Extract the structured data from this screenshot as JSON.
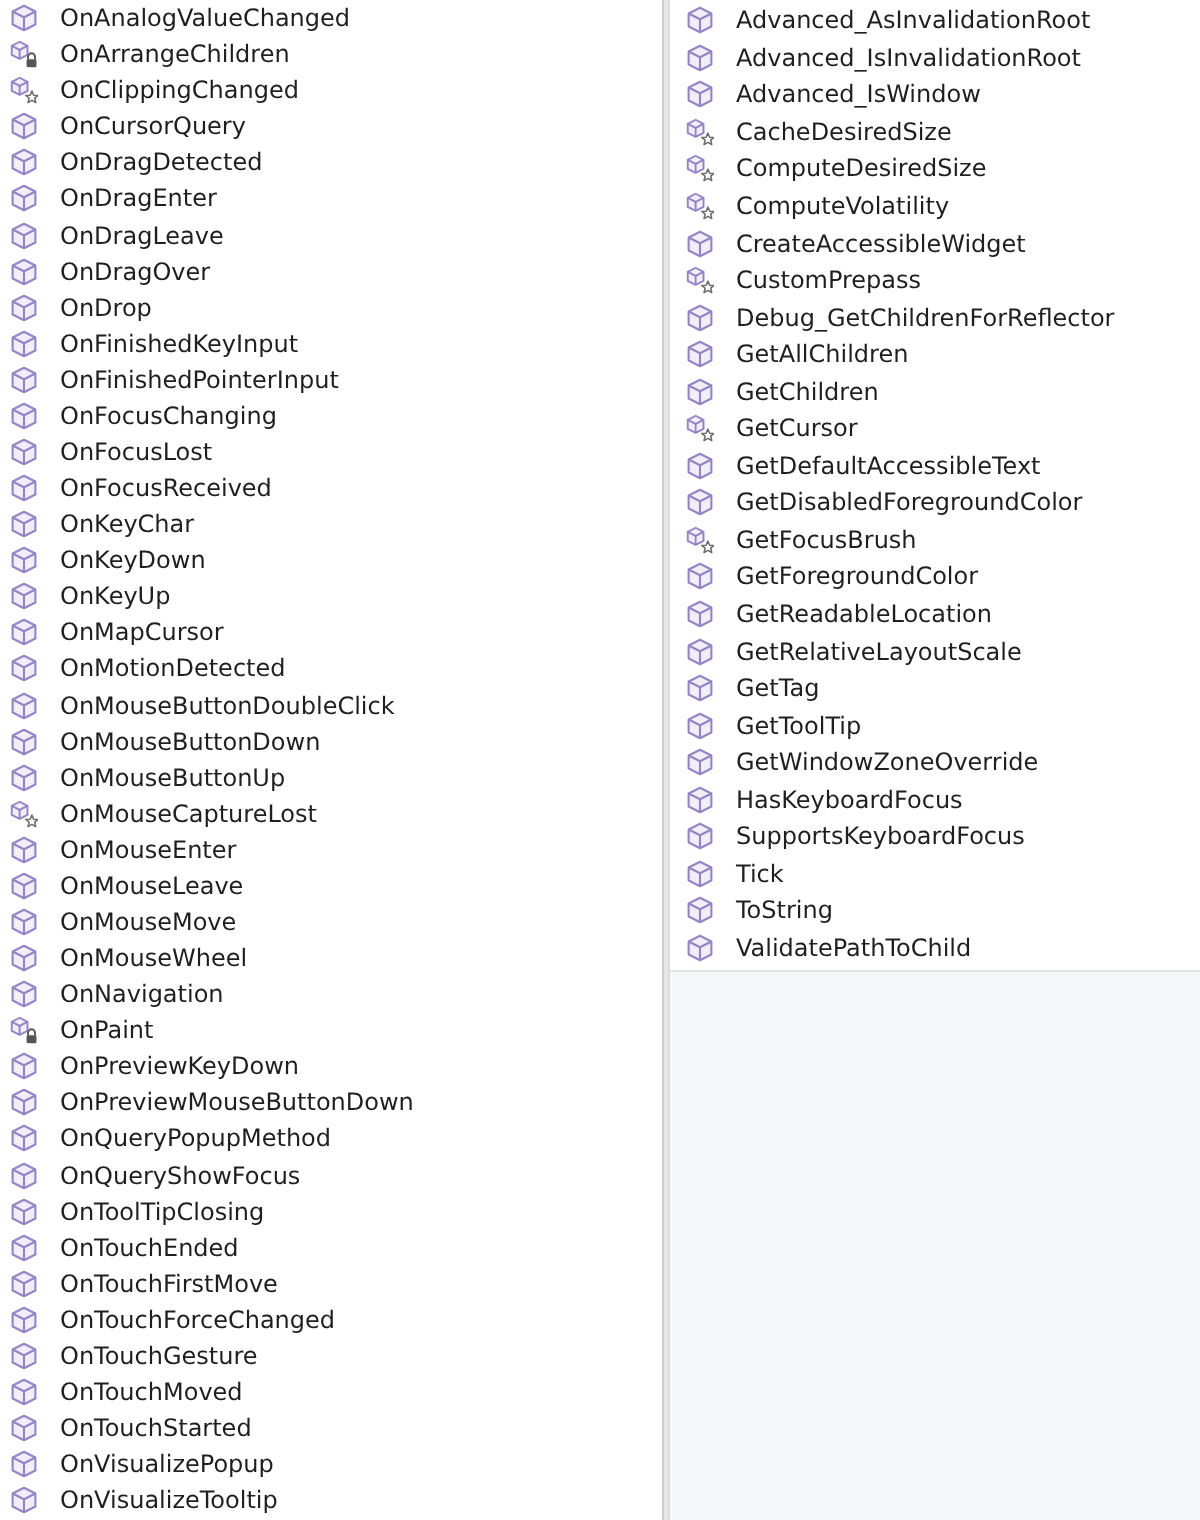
{
  "left_panel": {
    "items": [
      {
        "label": "OnAnalogValueChanged",
        "kind": "plain"
      },
      {
        "label": "OnArrangeChildren",
        "kind": "lock"
      },
      {
        "label": "OnClippingChanged",
        "kind": "star"
      },
      {
        "label": "OnCursorQuery",
        "kind": "plain"
      },
      {
        "label": "OnDragDetected",
        "kind": "plain"
      },
      {
        "label": "OnDragEnter",
        "kind": "plain"
      },
      {
        "label": "OnDragLeave",
        "kind": "plain"
      },
      {
        "label": "OnDragOver",
        "kind": "plain"
      },
      {
        "label": "OnDrop",
        "kind": "plain"
      },
      {
        "label": "OnFinishedKeyInput",
        "kind": "plain"
      },
      {
        "label": "OnFinishedPointerInput",
        "kind": "plain"
      },
      {
        "label": "OnFocusChanging",
        "kind": "plain"
      },
      {
        "label": "OnFocusLost",
        "kind": "plain"
      },
      {
        "label": "OnFocusReceived",
        "kind": "plain"
      },
      {
        "label": "OnKeyChar",
        "kind": "plain"
      },
      {
        "label": "OnKeyDown",
        "kind": "plain"
      },
      {
        "label": "OnKeyUp",
        "kind": "plain"
      },
      {
        "label": "OnMapCursor",
        "kind": "plain"
      },
      {
        "label": "OnMotionDetected",
        "kind": "plain"
      },
      {
        "label": "OnMouseButtonDoubleClick",
        "kind": "plain"
      },
      {
        "label": "OnMouseButtonDown",
        "kind": "plain"
      },
      {
        "label": "OnMouseButtonUp",
        "kind": "plain"
      },
      {
        "label": "OnMouseCaptureLost",
        "kind": "star"
      },
      {
        "label": "OnMouseEnter",
        "kind": "plain"
      },
      {
        "label": "OnMouseLeave",
        "kind": "plain"
      },
      {
        "label": "OnMouseMove",
        "kind": "plain"
      },
      {
        "label": "OnMouseWheel",
        "kind": "plain"
      },
      {
        "label": "OnNavigation",
        "kind": "plain"
      },
      {
        "label": "OnPaint",
        "kind": "lock"
      },
      {
        "label": "OnPreviewKeyDown",
        "kind": "plain"
      },
      {
        "label": "OnPreviewMouseButtonDown",
        "kind": "plain"
      },
      {
        "label": "OnQueryPopupMethod",
        "kind": "plain"
      },
      {
        "label": "OnQueryShowFocus",
        "kind": "plain"
      },
      {
        "label": "OnToolTipClosing",
        "kind": "plain"
      },
      {
        "label": "OnTouchEnded",
        "kind": "plain"
      },
      {
        "label": "OnTouchFirstMove",
        "kind": "plain"
      },
      {
        "label": "OnTouchForceChanged",
        "kind": "plain"
      },
      {
        "label": "OnTouchGesture",
        "kind": "plain"
      },
      {
        "label": "OnTouchMoved",
        "kind": "plain"
      },
      {
        "label": "OnTouchStarted",
        "kind": "plain"
      },
      {
        "label": "OnVisualizePopup",
        "kind": "plain"
      },
      {
        "label": "OnVisualizeTooltip",
        "kind": "plain"
      }
    ]
  },
  "right_panel": {
    "items": [
      {
        "label": "Advanced_AsInvalidationRoot",
        "kind": "plain"
      },
      {
        "label": "Advanced_IsInvalidationRoot",
        "kind": "plain"
      },
      {
        "label": "Advanced_IsWindow",
        "kind": "plain"
      },
      {
        "label": "CacheDesiredSize",
        "kind": "star"
      },
      {
        "label": "ComputeDesiredSize",
        "kind": "star"
      },
      {
        "label": "ComputeVolatility",
        "kind": "star"
      },
      {
        "label": "CreateAccessibleWidget",
        "kind": "plain"
      },
      {
        "label": "CustomPrepass",
        "kind": "star"
      },
      {
        "label": "Debug_GetChildrenForReflector",
        "kind": "plain"
      },
      {
        "label": "GetAllChildren",
        "kind": "plain"
      },
      {
        "label": "GetChildren",
        "kind": "plain"
      },
      {
        "label": "GetCursor",
        "kind": "star"
      },
      {
        "label": "GetDefaultAccessibleText",
        "kind": "plain"
      },
      {
        "label": "GetDisabledForegroundColor",
        "kind": "plain"
      },
      {
        "label": "GetFocusBrush",
        "kind": "star"
      },
      {
        "label": "GetForegroundColor",
        "kind": "plain"
      },
      {
        "label": "GetReadableLocation",
        "kind": "plain"
      },
      {
        "label": "GetRelativeLayoutScale",
        "kind": "plain"
      },
      {
        "label": "GetTag",
        "kind": "plain"
      },
      {
        "label": "GetToolTip",
        "kind": "plain"
      },
      {
        "label": "GetWindowZoneOverride",
        "kind": "plain"
      },
      {
        "label": "HasKeyboardFocus",
        "kind": "plain"
      },
      {
        "label": "SupportsKeyboardFocus",
        "kind": "plain"
      },
      {
        "label": "Tick",
        "kind": "plain"
      },
      {
        "label": "ToString",
        "kind": "plain"
      },
      {
        "label": "ValidatePathToChild",
        "kind": "plain"
      }
    ]
  }
}
